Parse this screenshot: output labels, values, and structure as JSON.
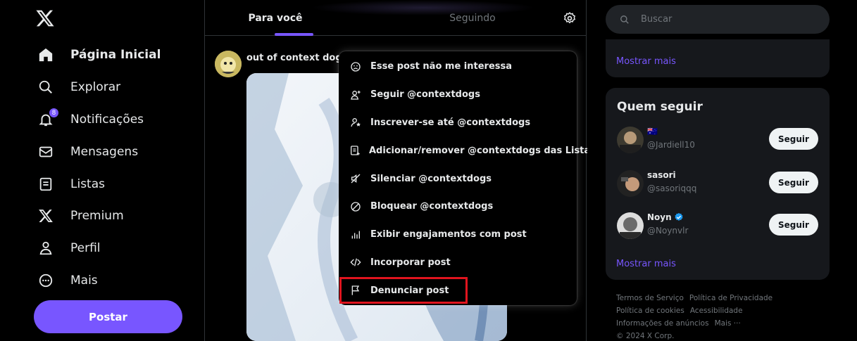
{
  "nav": {
    "items": [
      {
        "label": "Página Inicial",
        "icon": "home-icon"
      },
      {
        "label": "Explorar",
        "icon": "search-icon"
      },
      {
        "label": "Notificações",
        "icon": "bell-icon",
        "badge": "8"
      },
      {
        "label": "Mensagens",
        "icon": "mail-icon"
      },
      {
        "label": "Listas",
        "icon": "list-icon"
      },
      {
        "label": "Premium",
        "icon": "x-logo-icon"
      },
      {
        "label": "Perfil",
        "icon": "person-icon"
      },
      {
        "label": "Mais",
        "icon": "more-circle-icon"
      }
    ],
    "post_button": "Postar"
  },
  "timeline": {
    "tabs": [
      "Para você",
      "Seguindo"
    ],
    "post": {
      "author": "out of context dogs"
    }
  },
  "menu": {
    "items": [
      {
        "label": "Esse post não me interessa",
        "icon": "sad-face-icon"
      },
      {
        "label": "Seguir @contextdogs",
        "icon": "follow-user-icon"
      },
      {
        "label": "Inscrever-se até @contextdogs",
        "icon": "subscribe-user-icon"
      },
      {
        "label": "Adicionar/remover @contextdogs das Listas",
        "icon": "list-add-icon"
      },
      {
        "label": "Silenciar @contextdogs",
        "icon": "mute-icon"
      },
      {
        "label": "Bloquear @contextdogs",
        "icon": "block-icon"
      },
      {
        "label": "Exibir engajamentos com post",
        "icon": "stats-icon"
      },
      {
        "label": "Incorporar post",
        "icon": "code-icon"
      },
      {
        "label": "Denunciar post",
        "icon": "flag-icon"
      }
    ]
  },
  "sidebar": {
    "search_placeholder": "Buscar",
    "trends_more": "Mostrar mais",
    "who_to_follow": {
      "title": "Quem seguir",
      "users": [
        {
          "name": "🇦🇺",
          "handle": "@Jardiell10",
          "verified": false
        },
        {
          "name": "sasori",
          "handle": "@sasoriqqq",
          "verified": false
        },
        {
          "name": "Noyn",
          "handle": "@Noynvlr",
          "verified": true
        }
      ],
      "follow_label": "Seguir",
      "more": "Mostrar mais"
    },
    "footer": [
      "Termos de Serviço",
      "Política de Privacidade",
      "Política de cookies",
      "Acessibilidade",
      "Informações de anúncios",
      "Mais ···",
      "© 2024 X Corp."
    ]
  },
  "colors": {
    "accent": "#7856ff",
    "highlight": "#e0141e",
    "verified": "#1d9bf0"
  }
}
